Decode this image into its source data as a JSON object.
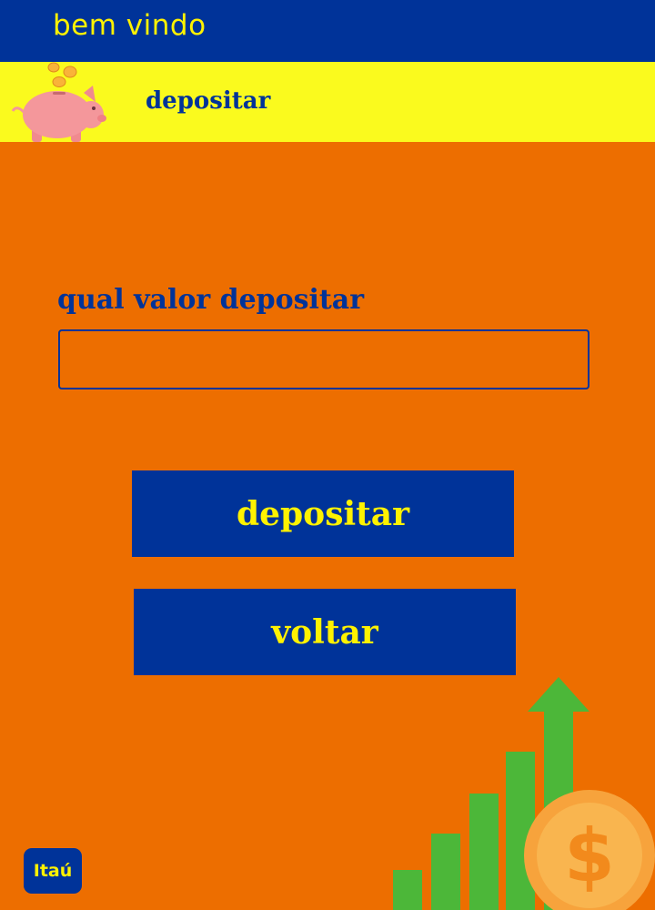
{
  "header": {
    "welcome_text": "bem vindo"
  },
  "section": {
    "title": "depositar",
    "icon": "piggy-bank-icon"
  },
  "form": {
    "label": "qual valor depositar",
    "amount_value": "",
    "amount_placeholder": ""
  },
  "actions": {
    "deposit_label": "depositar",
    "back_label": "voltar"
  },
  "footer": {
    "logo_text": "Itaú",
    "illustration": "growth-chart-with-dollar-coin"
  },
  "colors": {
    "background": "#ed6e00",
    "primary": "#003399",
    "accent": "#fff200",
    "section_bar": "#fafa1e",
    "chart_green": "#4cb739",
    "coin": "#f7a33c"
  }
}
